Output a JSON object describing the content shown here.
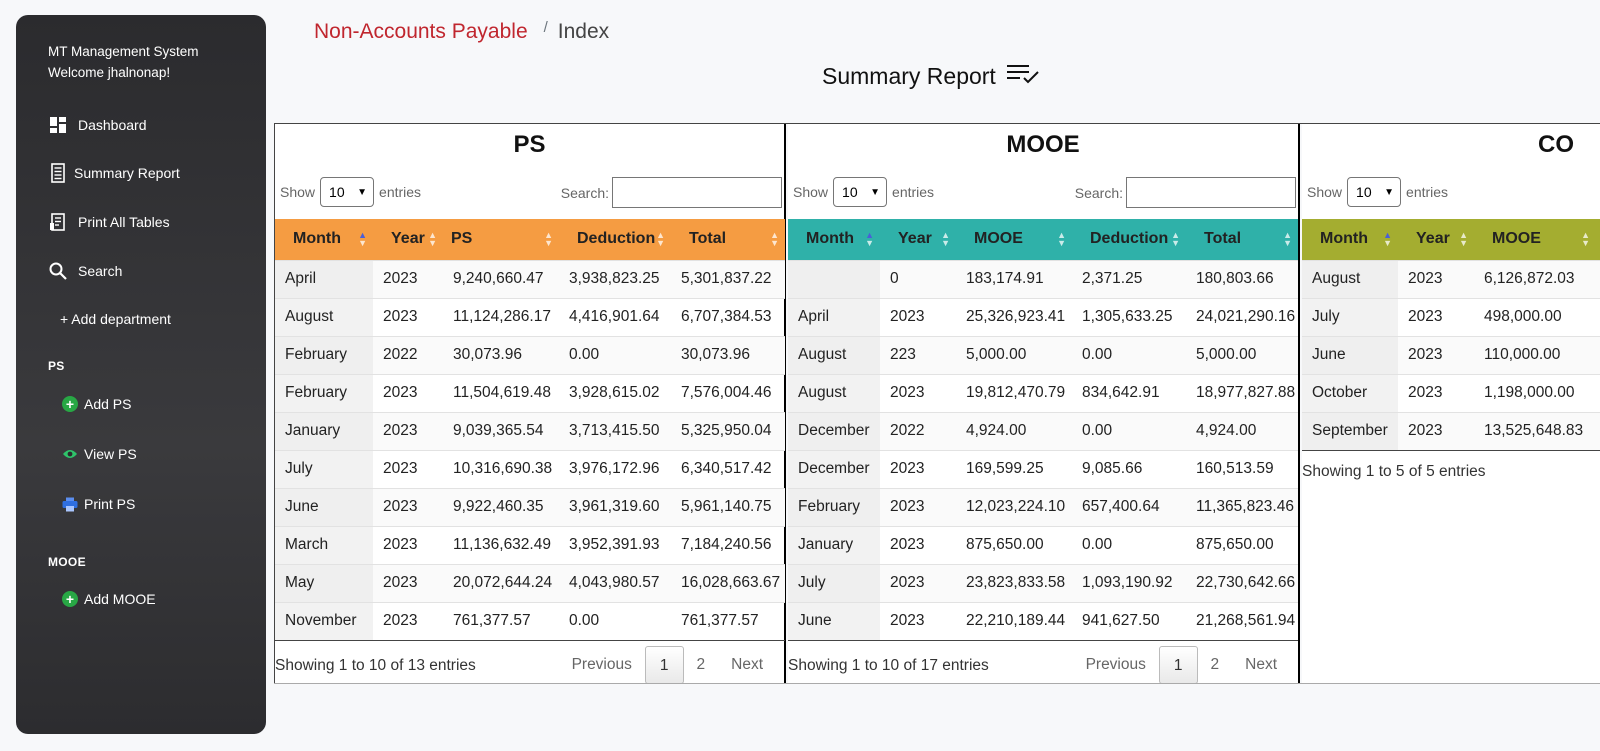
{
  "sidebar": {
    "brand_line1": "MT Management System",
    "brand_line2": "Welcome jhalnonap!",
    "nav": [
      {
        "label": "Dashboard",
        "icon": "dashboard-icon"
      },
      {
        "label": "Summary Report",
        "icon": "document-icon"
      },
      {
        "label": "Print All Tables",
        "icon": "print-list-icon"
      },
      {
        "label": "Search",
        "icon": "search-icon"
      },
      {
        "label": "+ Add department"
      }
    ],
    "ps_section": "PS",
    "ps_items": [
      {
        "label": "Add PS",
        "icon": "add-circle-icon"
      },
      {
        "label": "View PS",
        "icon": "eye-icon"
      },
      {
        "label": "Print PS",
        "icon": "printer-icon"
      }
    ],
    "mooe_section": "MOOE",
    "mooe_items": [
      {
        "label": "Add MOOE",
        "icon": "add-circle-icon"
      }
    ]
  },
  "breadcrumb": {
    "link": "Non-Accounts Payable",
    "separator": "/",
    "current": "Index"
  },
  "page_title": "Summary Report",
  "colors": {
    "ps_header": "#f59c42",
    "mooe_header": "#2fb1a9",
    "co_header": "#a4ad30",
    "breadcrumb_link": "#c0262e"
  },
  "panels": [
    {
      "title": "PS",
      "show_label": "Show",
      "entries_value": "10",
      "entries_label": "entries",
      "search_label": "Search:",
      "columns": [
        "Month",
        "Year",
        "PS",
        "Deduction",
        "Total"
      ],
      "rows": [
        [
          "April",
          "2023",
          "9,240,660.47",
          "3,938,823.25",
          "5,301,837.22"
        ],
        [
          "August",
          "2023",
          "11,124,286.17",
          "4,416,901.64",
          "6,707,384.53"
        ],
        [
          "February",
          "2022",
          "30,073.96",
          "0.00",
          "30,073.96"
        ],
        [
          "February",
          "2023",
          "11,504,619.48",
          "3,928,615.02",
          "7,576,004.46"
        ],
        [
          "January",
          "2023",
          "9,039,365.54",
          "3,713,415.50",
          "5,325,950.04"
        ],
        [
          "July",
          "2023",
          "10,316,690.38",
          "3,976,172.96",
          "6,340,517.42"
        ],
        [
          "June",
          "2023",
          "9,922,460.35",
          "3,961,319.60",
          "5,961,140.75"
        ],
        [
          "March",
          "2023",
          "11,136,632.49",
          "3,952,391.93",
          "7,184,240.56"
        ],
        [
          "May",
          "2023",
          "20,072,644.24",
          "4,043,980.57",
          "16,028,663.67"
        ],
        [
          "November",
          "2023",
          "761,377.57",
          "0.00",
          "761,377.57"
        ]
      ],
      "info": "Showing 1 to 10 of 13 entries",
      "previous": "Previous",
      "pages": [
        "1",
        "2"
      ],
      "next": "Next"
    },
    {
      "title": "MOOE",
      "show_label": "Show",
      "entries_value": "10",
      "entries_label": "entries",
      "search_label": "Search:",
      "columns": [
        "Month",
        "Year",
        "MOOE",
        "Deduction",
        "Total"
      ],
      "rows": [
        [
          "",
          "0",
          "183,174.91",
          "2,371.25",
          "180,803.66"
        ],
        [
          "April",
          "2023",
          "25,326,923.41",
          "1,305,633.25",
          "24,021,290.16"
        ],
        [
          "August",
          "223",
          "5,000.00",
          "0.00",
          "5,000.00"
        ],
        [
          "August",
          "2023",
          "19,812,470.79",
          "834,642.91",
          "18,977,827.88"
        ],
        [
          "December",
          "2022",
          "4,924.00",
          "0.00",
          "4,924.00"
        ],
        [
          "December",
          "2023",
          "169,599.25",
          "9,085.66",
          "160,513.59"
        ],
        [
          "February",
          "2023",
          "12,023,224.10",
          "657,400.64",
          "11,365,823.46"
        ],
        [
          "January",
          "2023",
          "875,650.00",
          "0.00",
          "875,650.00"
        ],
        [
          "July",
          "2023",
          "23,823,833.58",
          "1,093,190.92",
          "22,730,642.66"
        ],
        [
          "June",
          "2023",
          "22,210,189.44",
          "941,627.50",
          "21,268,561.94"
        ]
      ],
      "info": "Showing 1 to 10 of 17 entries",
      "previous": "Previous",
      "pages": [
        "1",
        "2"
      ],
      "next": "Next"
    },
    {
      "title": "CO",
      "show_label": "Show",
      "entries_value": "10",
      "entries_label": "entries",
      "columns": [
        "Month",
        "Year",
        "MOOE"
      ],
      "rows": [
        [
          "August",
          "2023",
          "6,126,872.03"
        ],
        [
          "July",
          "2023",
          "498,000.00"
        ],
        [
          "June",
          "2023",
          "110,000.00"
        ],
        [
          "October",
          "2023",
          "1,198,000.00"
        ],
        [
          "September",
          "2023",
          "13,525,648.83"
        ]
      ],
      "info": "Showing 1 to 5 of 5 entries"
    }
  ]
}
